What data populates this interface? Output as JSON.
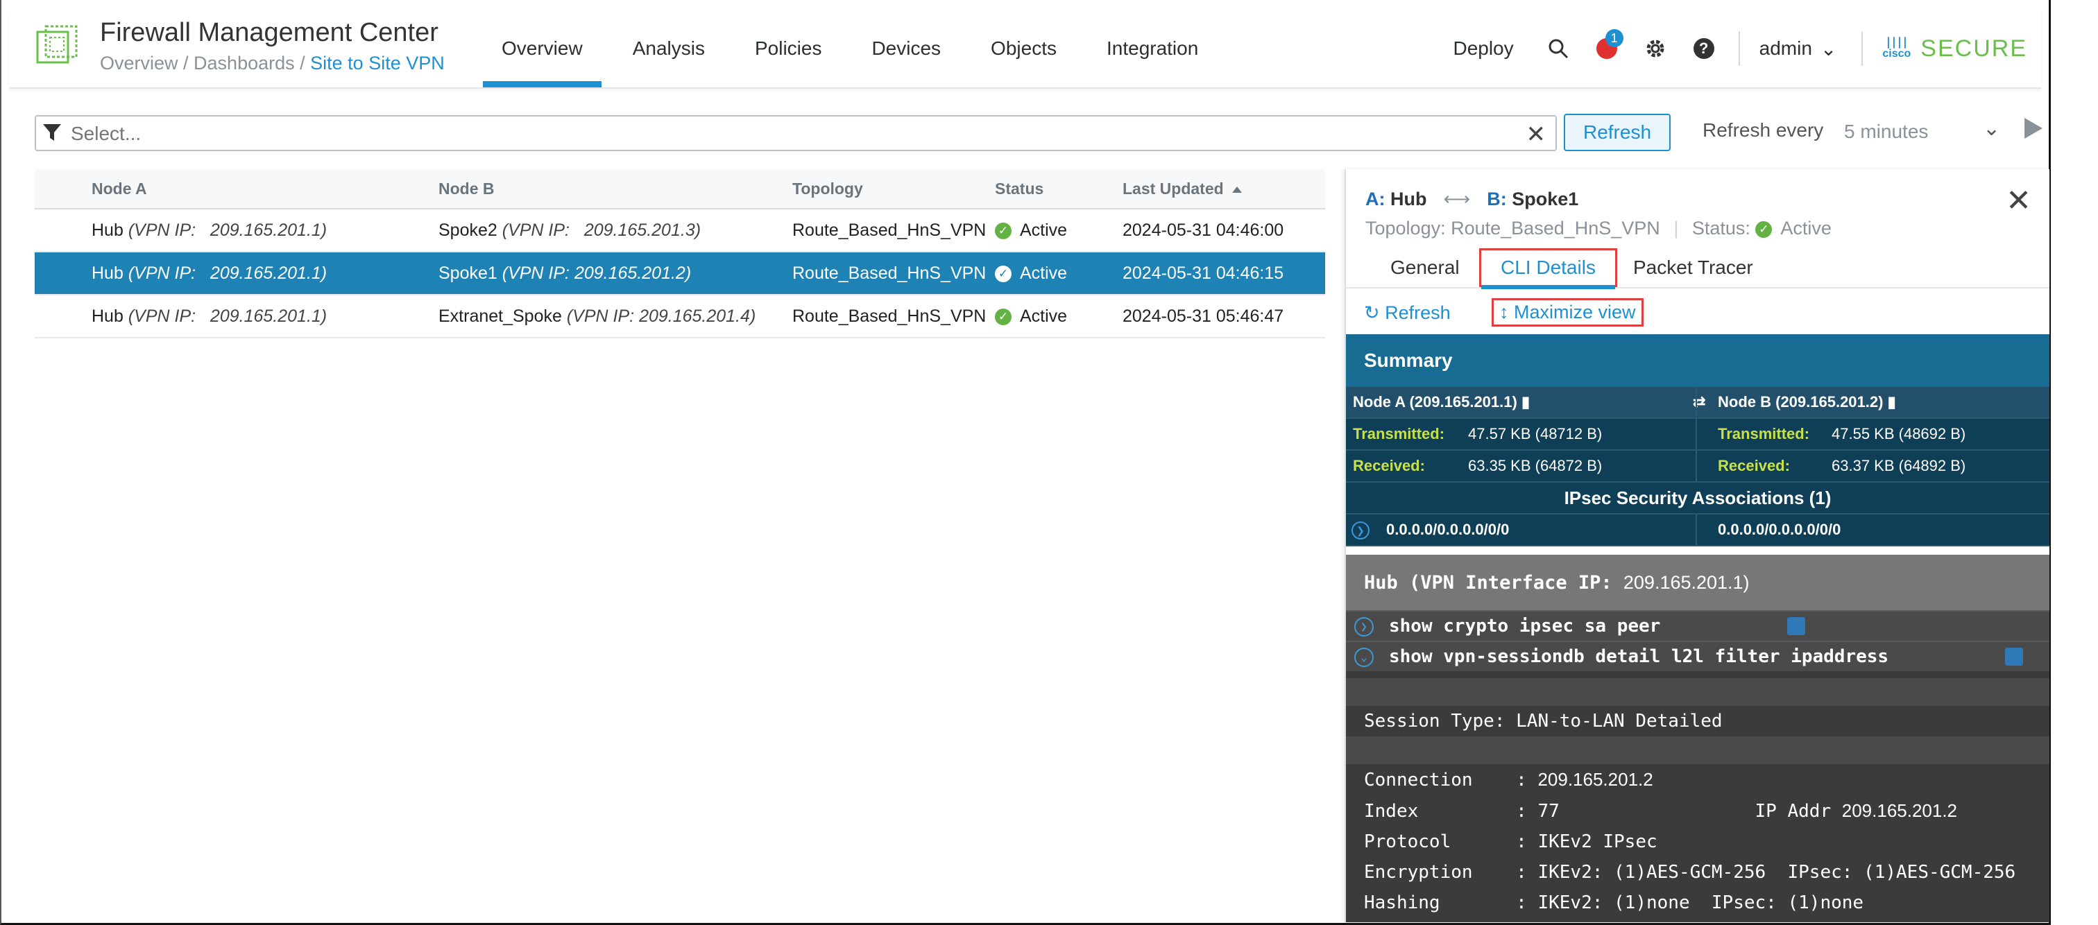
{
  "header": {
    "app_title": "Firewall Management Center",
    "breadcrumb": [
      "Overview",
      "Dashboards",
      "Site to Site VPN"
    ],
    "nav": [
      "Overview",
      "Analysis",
      "Policies",
      "Devices",
      "Objects",
      "Integration"
    ],
    "active_nav": "Overview",
    "deploy": "Deploy",
    "alert_count": "1",
    "user": "admin",
    "brand_cisco": "cisco",
    "brand_secure": "SECURE"
  },
  "filter": {
    "placeholder": "Select...",
    "refresh_button": "Refresh",
    "refresh_every_label": "Refresh every",
    "refresh_interval": "5 minutes"
  },
  "table": {
    "columns": [
      "Node A",
      "Node B",
      "Topology",
      "Status",
      "Last Updated"
    ],
    "rows": [
      {
        "a_name": "Hub",
        "a_vpn": "(VPN IP:",
        "a_ip": "209.165.201.1)",
        "b_name": "Spoke2",
        "b_vpn": "(VPN IP:",
        "b_ip": "209.165.201.3)",
        "topology": "Route_Based_HnS_VPN",
        "status": "Active",
        "updated": "2024-05-31 04:46:00"
      },
      {
        "a_name": "Hub",
        "a_vpn": "(VPN IP:",
        "a_ip": "209.165.201.1)",
        "b_name": "Spoke1",
        "b_vpn": "(VPN IP:",
        "b_ip": "209.165.201.2)",
        "topology": "Route_Based_HnS_VPN",
        "status": "Active",
        "updated": "2024-05-31 04:46:15"
      },
      {
        "a_name": "Hub",
        "a_vpn": "(VPN IP:",
        "a_ip": "209.165.201.1)",
        "b_name": "Extranet_Spoke",
        "b_vpn": "(VPN IP:",
        "b_ip": "209.165.201.4)",
        "topology": "Route_Based_HnS_VPN",
        "status": "Active",
        "updated": "2024-05-31 05:46:47"
      }
    ],
    "selected_row": 1
  },
  "panel": {
    "node_a_key": "A:",
    "node_a": "Hub",
    "node_b_key": "B:",
    "node_b": "Spoke1",
    "topology_label": "Topology:",
    "topology": "Route_Based_HnS_VPN",
    "status_label": "Status:",
    "status": "Active",
    "tabs": [
      "General",
      "CLI Details",
      "Packet Tracer"
    ],
    "active_tab": "CLI Details",
    "refresh_link": "Refresh",
    "maximize_link": "Maximize view",
    "summary_title": "Summary",
    "summary": {
      "node_a_header": "Node A (209.165.201.1)",
      "node_b_header": "Node B  (209.165.201.2)",
      "transmitted_label": "Transmitted:",
      "received_label": "Received:",
      "a_tx": "47.57 KB (48712 B)",
      "a_rx": "63.35 KB (64872 B)",
      "b_tx": "47.55 KB (48692 B)",
      "b_rx": "63.37 KB (64892 B)",
      "ipsec_title": "IPsec Security Associations (1)",
      "sa_a": "0.0.0.0/0.0.0.0/0/0",
      "sa_b": "0.0.0.0/0.0.0.0/0/0"
    },
    "cli": {
      "hub_label": "Hub (VPN Interface IP:",
      "hub_ip": "209.165.201.1)",
      "cmd1": "show crypto ipsec sa peer",
      "cmd2": "show vpn-sessiondb detail l2l filter ipaddress",
      "session_type": "Session Type: LAN-to-LAN Detailed",
      "connection_label": "Connection    : ",
      "connection": "209.165.201.2",
      "index_line": "Index         : 77                  IP Addr ",
      "ip_addr": "209.165.201.2",
      "protocol_line": "Protocol      : IKEv2 IPsec",
      "encryption_line": "Encryption    : IKEv2: (1)AES-GCM-256  IPsec: (1)AES-GCM-256",
      "hashing_line": "Hashing       : IKEv2: (1)none  IPsec: (1)none"
    }
  }
}
